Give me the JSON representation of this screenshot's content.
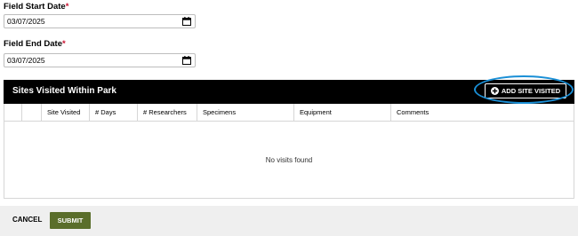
{
  "form": {
    "start": {
      "label": "Field Start Date",
      "required_mark": "*",
      "value": "03/07/2025"
    },
    "end": {
      "label": "Field End Date",
      "required_mark": "*",
      "value": "03/07/2025"
    }
  },
  "sites_table": {
    "title": "Sites Visited Within Park",
    "add_button_label": "ADD SITE VISITED",
    "columns": [
      "",
      "",
      "Site Visited",
      "# Days",
      "# Researchers",
      "Specimens",
      "Equipment",
      "Comments"
    ],
    "empty_message": "No visits found"
  },
  "footer": {
    "cancel_label": "CANCEL",
    "submit_label": "SUBMIT"
  },
  "colors": {
    "required": "#c8102e",
    "title_bar": "#000000",
    "submit": "#5a6e2b",
    "highlight": "#1a8fd6"
  },
  "icons": {
    "date_picker": "calendar-icon",
    "add": "plus-circle-icon"
  }
}
